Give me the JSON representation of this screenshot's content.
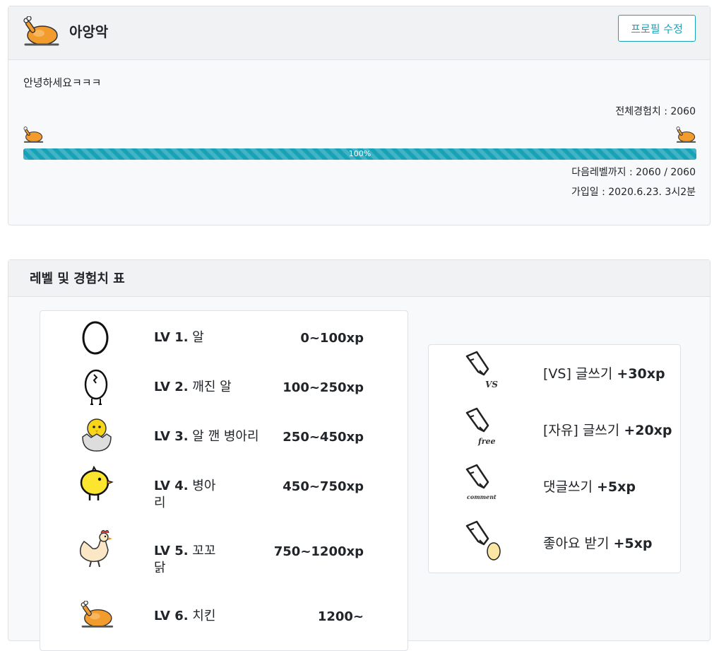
{
  "profile": {
    "name": "아앙악",
    "edit_button": "프로필 수정",
    "bio": "안녕하세요ㅋㅋㅋ",
    "total_exp": "전체경험치 : 2060",
    "progress_value": 1.0,
    "progress_label": "100%",
    "next_level": "다음레벨까지 : 2060 / 2060",
    "joined": "가입일 : 2020.6.23. 3시2분"
  },
  "level_section": {
    "title": "레벨 및 경험치 표",
    "levels": [
      {
        "lv": "LV 1.",
        "name": "알",
        "xp": "0~100xp",
        "icon": "egg-icon"
      },
      {
        "lv": "LV 2.",
        "name": "깨진 알",
        "xp": "100~250xp",
        "icon": "cracked-egg-icon"
      },
      {
        "lv": "LV 3.",
        "name": "알 깬 병아리",
        "xp": "250~450xp",
        "icon": "hatched-chick-icon"
      },
      {
        "lv": "LV 4.",
        "name": "병아리",
        "xp": "450~750xp",
        "icon": "chick-icon"
      },
      {
        "lv": "LV 5.",
        "name": "꼬꼬닭",
        "xp": "750~1200xp",
        "icon": "hen-icon"
      },
      {
        "lv": "LV 6.",
        "name": "치킨",
        "xp": "1200~",
        "icon": "roast-chicken-icon"
      }
    ],
    "actions": [
      {
        "label": "[VS] 글쓰기",
        "xp": "+30xp",
        "tag": "VS",
        "icon": "pencil-vs-icon"
      },
      {
        "label": "[자유] 글쓰기",
        "xp": "+20xp",
        "tag": "free",
        "icon": "pencil-free-icon"
      },
      {
        "label": "댓글쓰기",
        "xp": "+5xp",
        "tag": "comment",
        "icon": "pencil-comment-icon"
      },
      {
        "label": "좋아요 받기",
        "xp": "+5xp",
        "tag": "",
        "icon": "pencil-egg-icon"
      }
    ]
  }
}
